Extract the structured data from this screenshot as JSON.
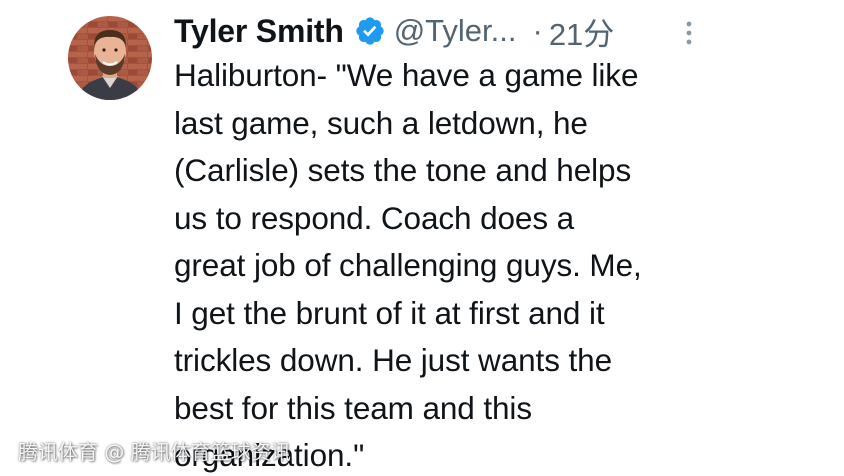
{
  "author": {
    "display_name": "Tyler Smith",
    "handle": "@Tyler...",
    "separator": "·",
    "time": "21分",
    "verified_icon": "verified-badge-icon",
    "avatar_icon": "avatar"
  },
  "tweet": {
    "text": "Haliburton- \"We have a game like\nlast game, such a letdown, he\n(Carlisle) sets the tone and helps\nus to respond. Coach does a\ngreat job of challenging guys. Me,\nI get the brunt of it at first and it\ntrickles down. He just wants the\nbest for this team and this\norganization.\""
  },
  "menu": {
    "icon": "more-options-icon"
  },
  "watermark": {
    "text": "腾讯体育 @ 腾讯体育篮球资讯"
  },
  "colors": {
    "primary_text": "#0f1419",
    "secondary_text": "#536471",
    "verified_blue": "#1d9bf0",
    "background": "#ffffff"
  }
}
